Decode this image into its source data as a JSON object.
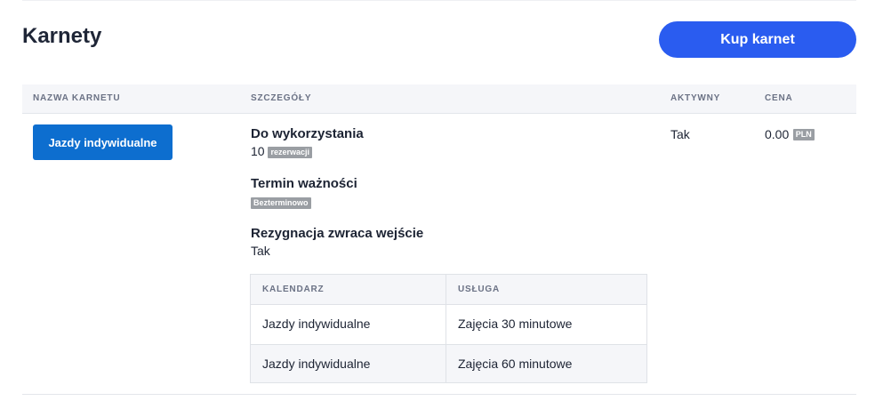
{
  "header": {
    "title": "Karnety",
    "buy_button": "Kup karnet"
  },
  "table": {
    "columns": [
      "NAZWA KARNETU",
      "SZCZEGÓŁY",
      "AKTYWNY",
      "CENA"
    ],
    "rows": [
      {
        "name": "Jazdy indywidualne",
        "details": {
          "usage_title": "Do wykorzystania",
          "usage_value": "10",
          "usage_unit": "rezerwacji",
          "validity_title": "Termin ważności",
          "validity_badge": "Bezterminowo",
          "cancel_title": "Rezygnacja zwraca wejście",
          "cancel_value": "Tak",
          "services": {
            "columns": [
              "KALENDARZ",
              "USŁUGA"
            ],
            "rows": [
              [
                "Jazdy indywidualne",
                "Zajęcia 30 minutowe"
              ],
              [
                "Jazdy indywidualne",
                "Zajęcia 60 minutowe"
              ]
            ]
          }
        },
        "active": "Tak",
        "price": "0.00",
        "currency": "PLN"
      }
    ]
  },
  "colors": {
    "primary_button": "#2a5cf0",
    "pass_button": "#0d6ecf",
    "badge": "#9a9ea3"
  }
}
